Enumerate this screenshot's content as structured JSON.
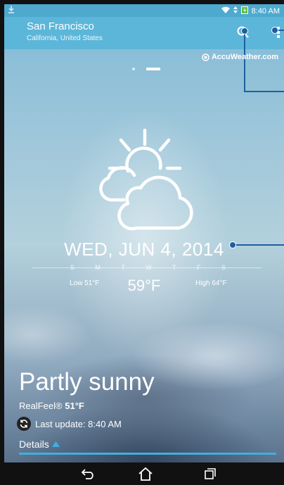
{
  "status": {
    "time": "8:40 AM",
    "notification_icon": "download-icon"
  },
  "header": {
    "city": "San Francisco",
    "region": "California, United States"
  },
  "provider": "AccuWeather.com",
  "forecast": {
    "date": "WED, JUN 4, 2014",
    "days": [
      "S",
      "M",
      "T",
      "W",
      "T",
      "F",
      "S"
    ],
    "low": "Low 51°F",
    "high": "High 64°F",
    "temperature": "59°F"
  },
  "conditions": {
    "summary": "Partly sunny",
    "realfeel_label": "RealFeel®",
    "realfeel_value": "51°F",
    "last_update": "Last update: 8:40 AM"
  },
  "details": {
    "label": "Details"
  },
  "colors": {
    "header": "#5cb6d9",
    "statusbar": "#4ea9cf",
    "accent": "#3fb0e0",
    "annotation": "#1e5fa0"
  }
}
